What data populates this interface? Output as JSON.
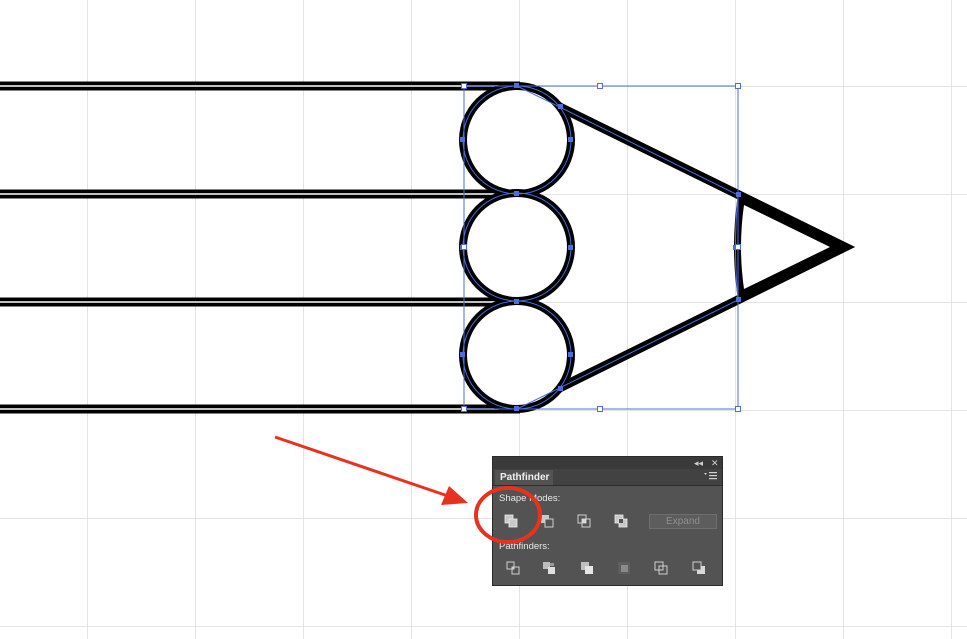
{
  "panel": {
    "collapse_icon": "double-chevron-left-icon",
    "close_icon": "close-icon",
    "collapse_glyph": "◂◂",
    "close_glyph": "✕",
    "tab_label": "Pathfinder",
    "menu_icon": "panel-menu-icon",
    "shape_modes_label": "Shape Modes:",
    "shape_mode_buttons": [
      "unite",
      "minus-front",
      "intersect",
      "exclude"
    ],
    "expand_label": "Expand",
    "pathfinders_label": "Pathfinders:",
    "pathfinder_buttons": [
      "divide",
      "trim",
      "merge",
      "crop",
      "outline",
      "minus-back"
    ]
  },
  "colors": {
    "canvas": "#ffffff",
    "grid": "#e3e3e3",
    "artwork": "#000000",
    "selection": "#4f6fd6",
    "annotation": "#e8321f",
    "panel_bg": "#535353"
  }
}
